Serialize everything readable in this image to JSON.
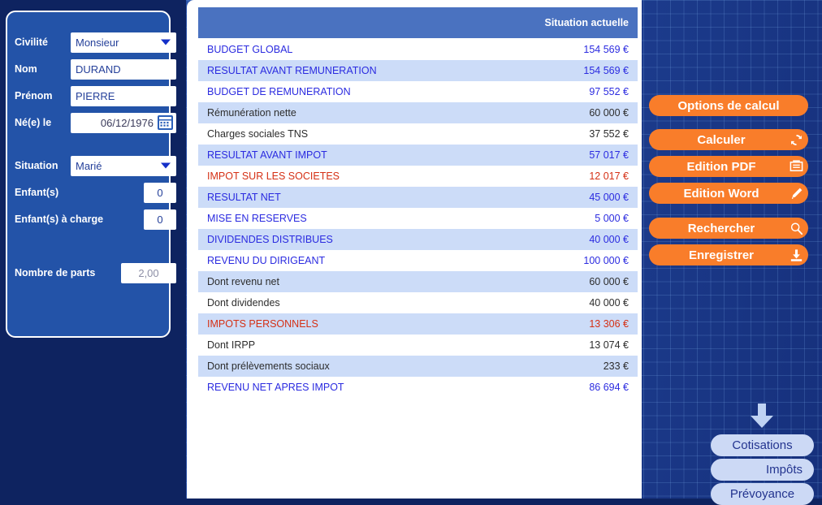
{
  "left_panel": {
    "fields": [
      {
        "name": "civilite",
        "label": "Civilité",
        "type": "select",
        "value": "Monsieur"
      },
      {
        "name": "nom",
        "label": "Nom",
        "type": "text",
        "value": "DURAND"
      },
      {
        "name": "prenom",
        "label": "Prénom",
        "type": "text",
        "value": "PIERRE"
      },
      {
        "name": "naissance",
        "label": "Né(e) le",
        "type": "date",
        "value": "06/12/1976"
      },
      {
        "name": "situation",
        "label": "Situation",
        "type": "select",
        "value": "Marié"
      },
      {
        "name": "enfants",
        "label": "Enfant(s)",
        "type": "number",
        "value": "0"
      },
      {
        "name": "enfants_charge",
        "label": "Enfant(s) à charge",
        "type": "number",
        "value": "0"
      },
      {
        "name": "nombre_parts",
        "label": "Nombre de parts",
        "type": "readonly",
        "value": "2,00"
      }
    ],
    "icons": {
      "select_chevron": "chevron-down-icon",
      "date_picker": "calendar-icon"
    }
  },
  "results": {
    "column_header": "Situation actuelle",
    "rows": [
      {
        "label": "BUDGET GLOBAL",
        "value": "154 569 €",
        "level": "major",
        "alt": false
      },
      {
        "label": "RESULTAT AVANT REMUNERATION",
        "value": "154 569 €",
        "level": "major",
        "alt": true
      },
      {
        "label": "BUDGET DE REMUNERATION",
        "value": "97 552 €",
        "level": "major",
        "alt": false
      },
      {
        "label": "Rémunération nette",
        "value": "60 000 €",
        "level": "detail",
        "alt": true
      },
      {
        "label": "Charges sociales TNS",
        "value": "37 552 €",
        "level": "detail",
        "alt": false
      },
      {
        "label": "RESULTAT AVANT IMPOT",
        "value": "57 017 €",
        "level": "major",
        "alt": true
      },
      {
        "label": "IMPOT SUR LES SOCIETES",
        "value": "12 017 €",
        "level": "tax",
        "alt": false
      },
      {
        "label": "RESULTAT NET",
        "value": "45 000 €",
        "level": "major",
        "alt": true
      },
      {
        "label": "MISE EN RESERVES",
        "value": "5 000 €",
        "level": "major",
        "alt": false
      },
      {
        "label": "DIVIDENDES DISTRIBUES",
        "value": "40 000 €",
        "level": "major",
        "alt": true
      },
      {
        "label": "REVENU DU DIRIGEANT",
        "value": "100 000 €",
        "level": "major",
        "alt": false
      },
      {
        "label": "Dont revenu net",
        "value": "60 000 €",
        "level": "detail",
        "alt": true
      },
      {
        "label": "Dont dividendes",
        "value": "40 000 €",
        "level": "detail",
        "alt": false
      },
      {
        "label": "IMPOTS PERSONNELS",
        "value": "13 306 €",
        "level": "tax",
        "alt": true
      },
      {
        "label": "Dont IRPP",
        "value": "13 074 €",
        "level": "detail",
        "alt": false
      },
      {
        "label": "Dont prélèvements sociaux",
        "value": "233 €",
        "level": "detail",
        "alt": true
      },
      {
        "label": "REVENU NET APRES IMPOT",
        "value": "86 694 €",
        "level": "major",
        "alt": false
      }
    ]
  },
  "detail_buttons": {
    "arrow_icon": "arrow-down-icon",
    "items": [
      {
        "name": "cotisations",
        "label": "Cotisations",
        "align": "center"
      },
      {
        "name": "impots",
        "label": "Impôts",
        "align": "right"
      },
      {
        "name": "prevoyance",
        "label": "Prévoyance",
        "align": "center"
      }
    ]
  },
  "actions": [
    {
      "name": "options-de-calcul",
      "label": "Options de calcul",
      "icon": ""
    },
    {
      "name": "calculer",
      "label": "Calculer",
      "icon": "refresh-icon"
    },
    {
      "name": "edition-pdf",
      "label": "Edition PDF",
      "icon": "printer-icon"
    },
    {
      "name": "edition-word",
      "label": "Edition Word",
      "icon": "pencil-icon"
    },
    {
      "name": "rechercher",
      "label": "Rechercher",
      "icon": "magnifier-icon"
    },
    {
      "name": "enregistrer",
      "label": "Enregistrer",
      "icon": "download-icon"
    }
  ],
  "colors": {
    "accent_orange": "#f97d2a",
    "panel_blue": "#2353a8",
    "navy": "#0e2360",
    "header_blue": "#4a72c0",
    "row_alt": "#ccdcf8",
    "major_text": "#2b2be0",
    "tax_text": "#d53015",
    "pill_blue": "#ccd9f5"
  }
}
